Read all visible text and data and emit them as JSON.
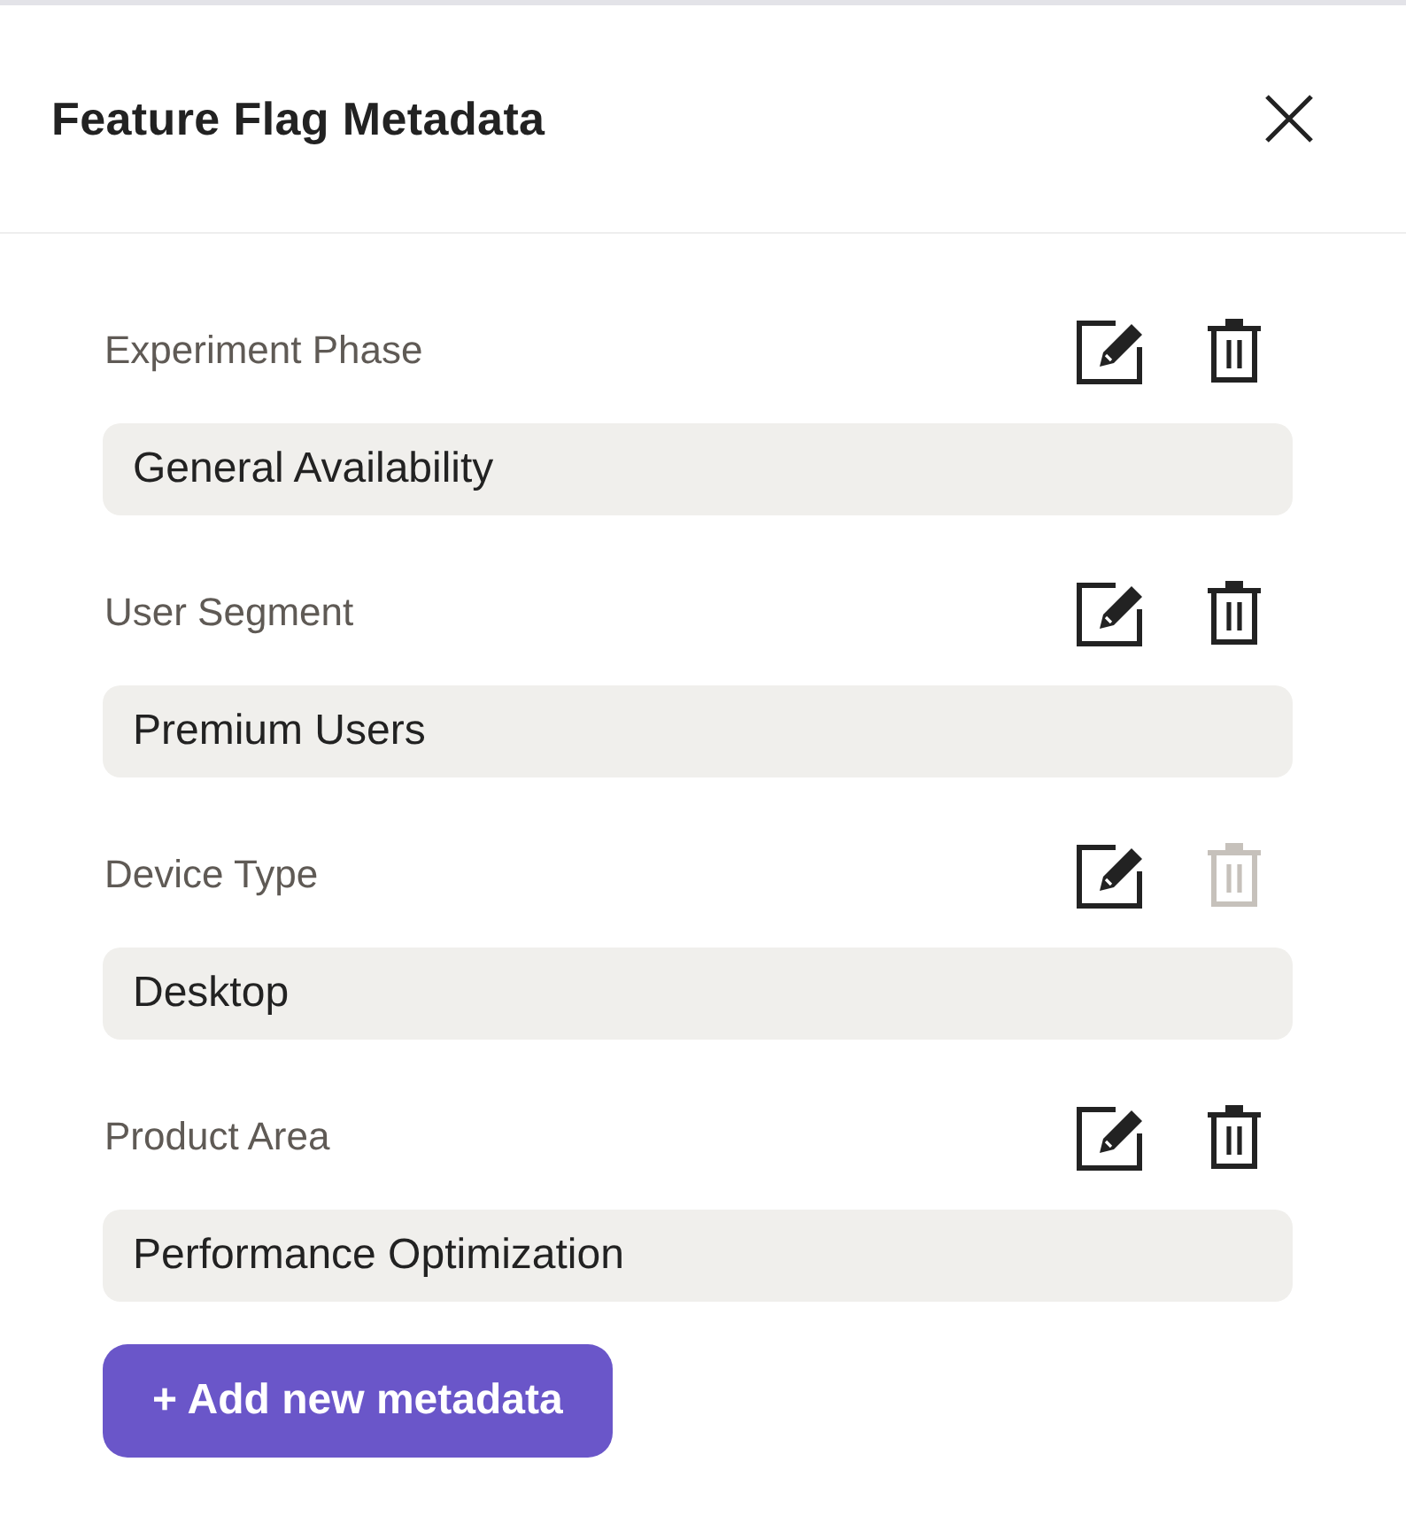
{
  "panel": {
    "title": "Feature Flag Metadata"
  },
  "entries": [
    {
      "label": "Experiment Phase",
      "value": "General Availability",
      "delete_disabled": false
    },
    {
      "label": "User Segment",
      "value": "Premium Users",
      "delete_disabled": false
    },
    {
      "label": "Device Type",
      "value": "Desktop",
      "delete_disabled": true
    },
    {
      "label": "Product Area",
      "value": "Performance Optimization",
      "delete_disabled": false
    }
  ],
  "add_button": {
    "label": "+ Add new metadata"
  }
}
